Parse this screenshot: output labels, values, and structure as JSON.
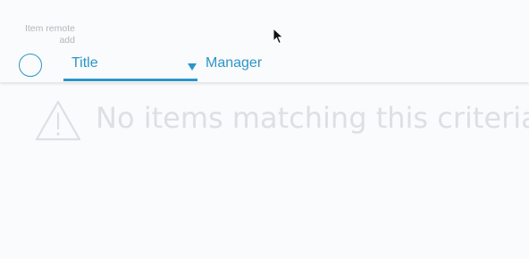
{
  "toolbar": {
    "remote_add_label": "Item remote add",
    "sort_field": {
      "value": "Title"
    },
    "column_manager_label": "Manager"
  },
  "empty_state": {
    "message": "No items matching this criteria",
    "icon": "warning-icon"
  },
  "colors": {
    "accent": "#2b96c9",
    "muted_text": "#b3b7bb",
    "empty_text": "#dde0e3",
    "background": "#fafbfc"
  }
}
